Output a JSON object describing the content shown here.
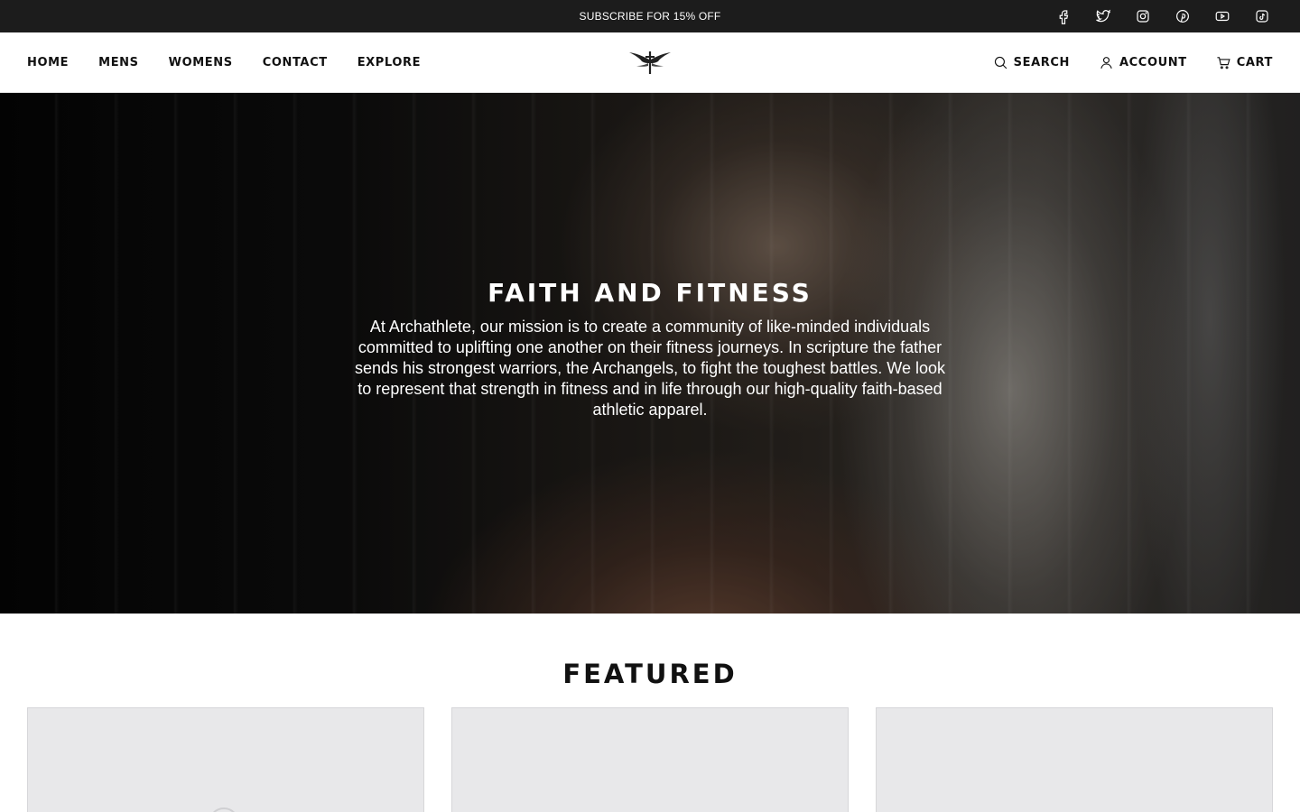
{
  "announcement": {
    "text": "SUBSCRIBE FOR 15% OFF",
    "socials": [
      {
        "name": "facebook-icon"
      },
      {
        "name": "twitter-icon"
      },
      {
        "name": "instagram-icon"
      },
      {
        "name": "pinterest-icon"
      },
      {
        "name": "youtube-icon"
      },
      {
        "name": "tiktok-icon"
      }
    ]
  },
  "nav": {
    "left": [
      "HOME",
      "MENS",
      "WOMENS",
      "CONTACT",
      "EXPLORE"
    ],
    "search_label": "SEARCH",
    "account_label": "ACCOUNT",
    "cart_label": "CART"
  },
  "hero": {
    "title": "FAITH AND FITNESS",
    "body": "At Archathlete, our mission is to create a community of like-minded individuals committed to uplifting one another on their fitness journeys. In scripture the father sends his strongest warriors, the Archangels, to fight the toughest battles. We look to represent that strength in fitness and in life through our high-quality faith-based athletic apparel."
  },
  "featured": {
    "title": "FEATURED"
  },
  "colors": {
    "topbar_bg": "#1c1c1c",
    "card_bg": "#e8e8ea"
  }
}
